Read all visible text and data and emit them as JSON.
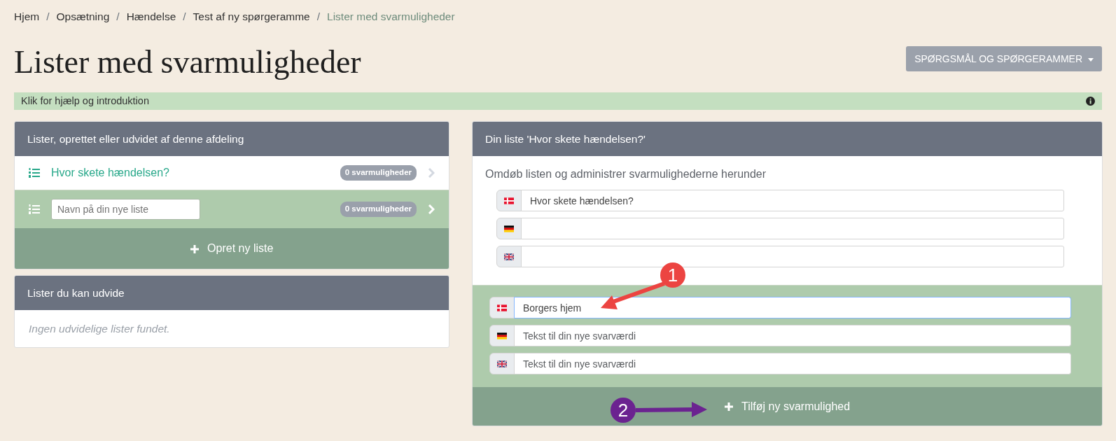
{
  "breadcrumb": [
    {
      "label": "Hjem",
      "current": false
    },
    {
      "separator": "/",
      "label": "Opsætning",
      "current": false
    },
    {
      "separator": "/",
      "label": "Hændelse",
      "current": false
    },
    {
      "separator": "/",
      "label": "Test af ny spørgeramme",
      "current": false
    },
    {
      "separator": "/",
      "label": "Lister med svarmuligheder",
      "current": true
    }
  ],
  "title": "Lister med svarmuligheder",
  "menu_button": "SPØRGSMÅL OG SPØRGERAMMER",
  "help_bar": "Klik for hjælp og introduktion",
  "own_lists": {
    "header": "Lister, oprettet eller udvidet af denne afdeling",
    "items": [
      {
        "kind": "link",
        "label": "Hvor skete hændelsen?",
        "badge": "0 svarmuligheder"
      },
      {
        "kind": "new",
        "placeholder": "Navn på din nye liste",
        "badge": "0 svarmuligheder"
      }
    ],
    "button": "Opret ny liste"
  },
  "extendable_lists": {
    "header": "Lister du kan udvide",
    "empty_text": "Ingen udvidelige lister fundet."
  },
  "list_editor": {
    "header": "Din liste 'Hvor skete hændelsen?'",
    "subtitle": "Omdøb listen og administrer svarmulighederne herunder",
    "name_fields": [
      {
        "kind": "danish",
        "value": "Hvor skete hændelsen?"
      },
      {
        "kind": "german"
      },
      {
        "kind": "english"
      }
    ],
    "new_option_fields": [
      {
        "kind": "danish",
        "value": "Borgers hjem",
        "focused": true
      },
      {
        "kind": "german",
        "placeholder": "Tekst til din nye svarværdi",
        "focused": false
      },
      {
        "kind": "english",
        "placeholder": "Tekst til din nye svarværdi",
        "focused": false
      }
    ],
    "button": "Tilføj ny svarmulighed"
  },
  "annotations": [
    {
      "label": "1",
      "color": "#ec4441"
    },
    {
      "label": "2",
      "color": "#6b2390"
    }
  ]
}
